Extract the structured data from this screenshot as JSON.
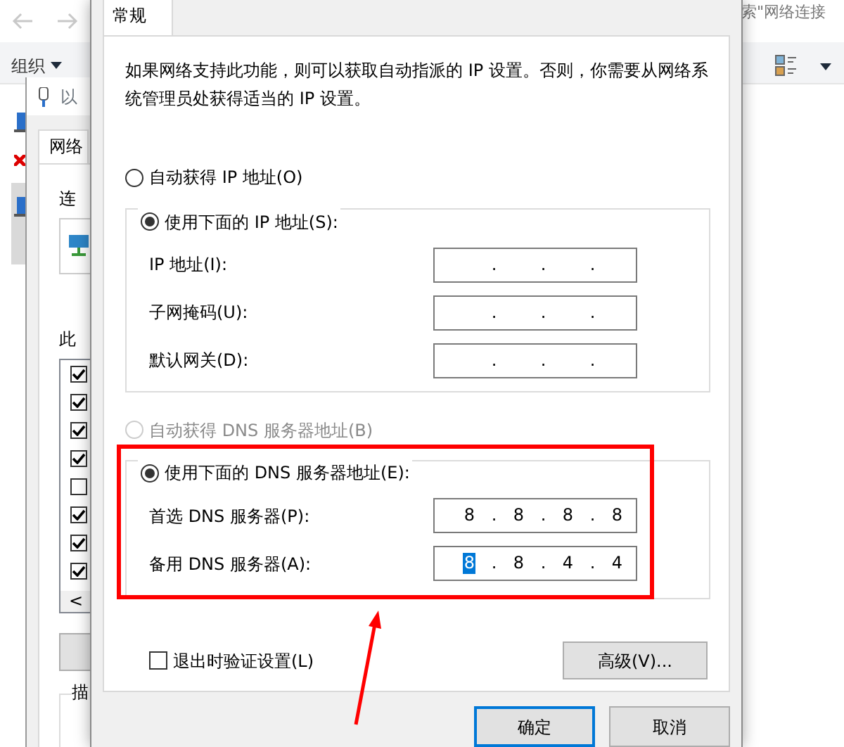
{
  "explorer": {
    "search_text": "索\"网络连接",
    "organize": "组织"
  },
  "back_window": {
    "title": "以",
    "tab": "网络",
    "connection_label": "连",
    "list_label": "此",
    "scroll_arrow": "<",
    "description_label": "描",
    "components": [
      {
        "checked": true
      },
      {
        "checked": true
      },
      {
        "checked": true
      },
      {
        "checked": true
      },
      {
        "checked": false
      },
      {
        "checked": true
      },
      {
        "checked": true
      },
      {
        "checked": true
      }
    ]
  },
  "dialog": {
    "tabs": [
      {
        "label": "常规",
        "selected": true
      }
    ],
    "description": "如果网络支持此功能，则可以获取自动指派的 IP 设置。否则，你需要从网络系统管理员处获得适当的 IP 设置。",
    "ip_mode": [
      {
        "label": "自动获得 IP 地址(O)",
        "selected": false,
        "disabled": false
      },
      {
        "label": "使用下面的 IP 地址(S):",
        "selected": true,
        "disabled": false
      }
    ],
    "ip_fields": [
      {
        "label": "IP 地址(I):",
        "dots": [
          ".",
          ".",
          "."
        ]
      },
      {
        "label": "子网掩码(U):",
        "dots": [
          ".",
          ".",
          "."
        ]
      },
      {
        "label": "默认网关(D):",
        "dots": [
          ".",
          ".",
          "."
        ]
      }
    ],
    "dns_mode": [
      {
        "label": "自动获得 DNS 服务器地址(B)",
        "selected": false,
        "disabled": true
      },
      {
        "label": "使用下面的 DNS 服务器地址(E):",
        "selected": true,
        "disabled": false
      }
    ],
    "dns_fields": [
      {
        "label": "首选 DNS 服务器(P):",
        "dots": [
          ".",
          ".",
          "."
        ],
        "octets": [
          {
            "text": "8",
            "selected": false
          },
          {
            "text": "8",
            "selected": false
          },
          {
            "text": "8",
            "selected": false
          },
          {
            "text": "8",
            "selected": false
          }
        ]
      },
      {
        "label": "备用 DNS 服务器(A):",
        "dots": [
          ".",
          ".",
          "."
        ],
        "octets": [
          {
            "text": "8",
            "selected": true
          },
          {
            "text": "8",
            "selected": false
          },
          {
            "text": "4",
            "selected": false
          },
          {
            "text": "4",
            "selected": false
          }
        ]
      }
    ],
    "validate": {
      "label": "退出时验证设置(L)",
      "checked": false
    },
    "advanced_button": "高级(V)...",
    "buttons": [
      {
        "label": "确定",
        "default": true
      },
      {
        "label": "取消",
        "default": false
      }
    ]
  }
}
